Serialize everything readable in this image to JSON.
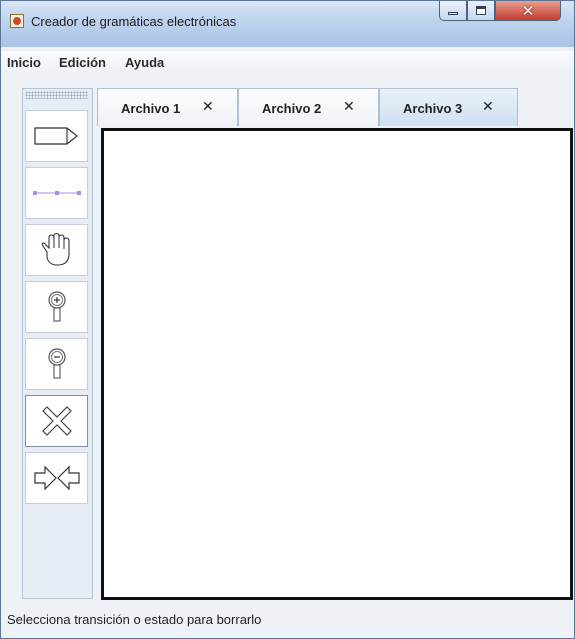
{
  "window": {
    "title": "Creador de gramáticas electrónicas"
  },
  "menu": [
    "Inicio",
    "Edición",
    "Ayuda"
  ],
  "toolbar": {
    "tools": [
      {
        "icon": "state-arrow-icon"
      },
      {
        "icon": "transition-line-icon"
      },
      {
        "icon": "hand-icon"
      },
      {
        "icon": "zoom-in-icon"
      },
      {
        "icon": "zoom-out-icon"
      },
      {
        "icon": "delete-x-icon",
        "selected": true
      },
      {
        "icon": "arrows-icon"
      }
    ]
  },
  "tabs": [
    {
      "label": "Archivo 1",
      "close": "✕",
      "active": false
    },
    {
      "label": "Archivo 2",
      "close": "✕",
      "active": false
    },
    {
      "label": "Archivo 3",
      "close": "✕",
      "active": true
    }
  ],
  "status": {
    "text": "Selecciona transición o estado para borrarlo"
  }
}
